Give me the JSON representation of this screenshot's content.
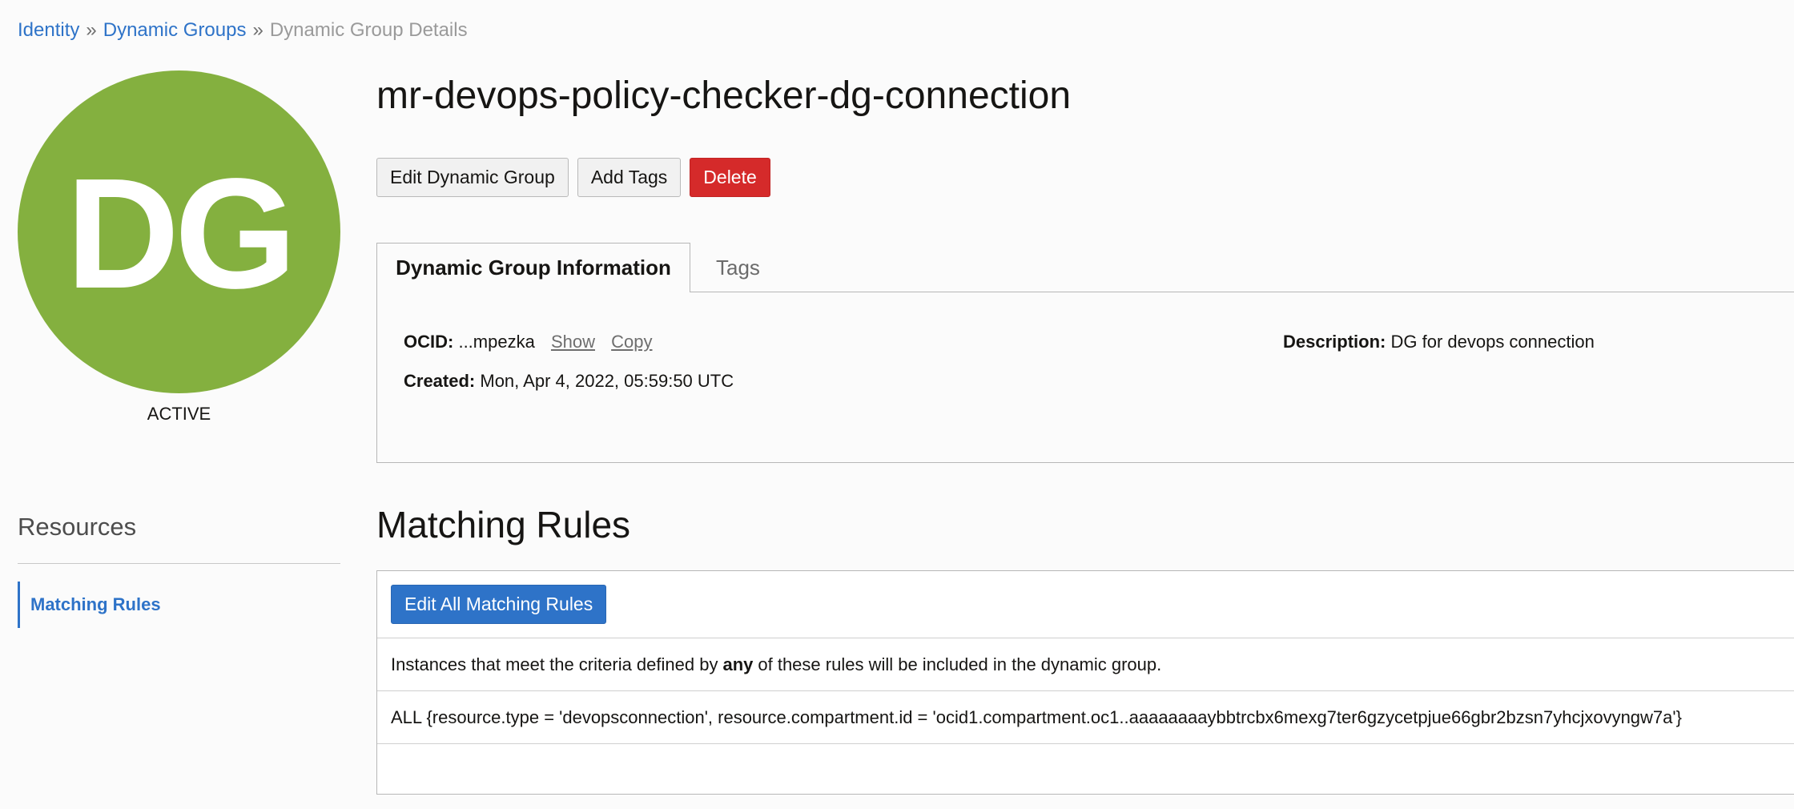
{
  "breadcrumb": {
    "items": [
      {
        "label": "Identity"
      },
      {
        "label": "Dynamic Groups"
      },
      {
        "label": "Dynamic Group Details"
      }
    ],
    "separator": "»"
  },
  "avatar": {
    "initials": "DG",
    "color": "#84b03f"
  },
  "status": "ACTIVE",
  "title": "mr-devops-policy-checker-dg-connection",
  "actions": {
    "edit_label": "Edit Dynamic Group",
    "tags_label": "Add Tags",
    "delete_label": "Delete"
  },
  "tabs": [
    {
      "label": "Dynamic Group Information",
      "active": true
    },
    {
      "label": "Tags",
      "active": false
    }
  ],
  "info": {
    "ocid_label": "OCID:",
    "ocid_value": "...mpezka",
    "show_label": "Show",
    "copy_label": "Copy",
    "created_label": "Created:",
    "created_value": "Mon, Apr 4, 2022, 05:59:50 UTC",
    "description_label": "Description:",
    "description_value": "DG for devops connection"
  },
  "resources": {
    "title": "Resources",
    "items": [
      {
        "label": "Matching Rules",
        "active": true
      }
    ]
  },
  "matching_rules": {
    "title": "Matching Rules",
    "edit_button_label": "Edit All Matching Rules",
    "description_before": "Instances that meet the criteria defined by",
    "description_bold": "any",
    "description_after": "of these rules will be included in the dynamic group.",
    "rules": [
      "ALL {resource.type = 'devopsconnection', resource.compartment.id = 'ocid1.compartment.oc1..aaaaaaaaybbtrcbx6mexg7ter6gzycetpjue66gbr2bzsn7yhcjxovyngw7a'}"
    ]
  },
  "colors": {
    "link": "#2e73c8",
    "danger": "#d52a2a",
    "primary": "#2e73c8",
    "avatar": "#84b03f"
  }
}
